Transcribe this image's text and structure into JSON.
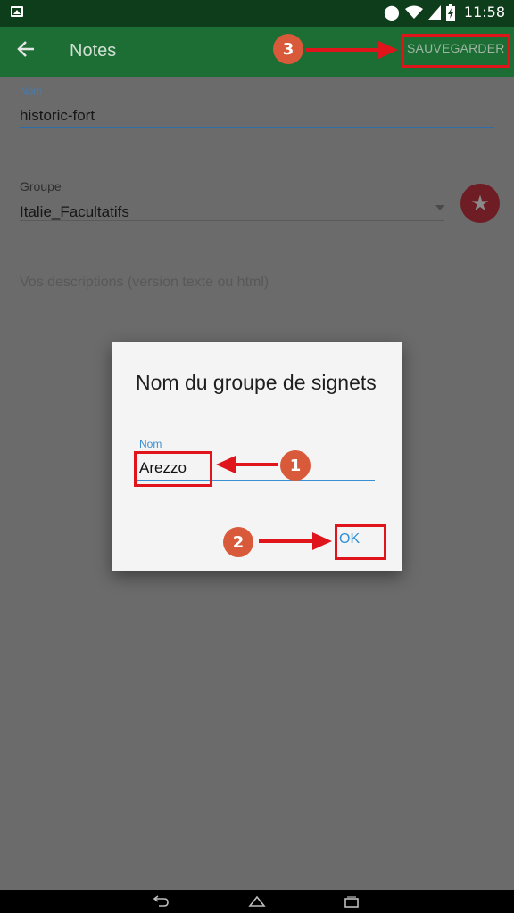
{
  "status_bar": {
    "time": "11:58"
  },
  "app_bar": {
    "title": "Notes",
    "save_label": "SAUVEGARDER"
  },
  "form": {
    "name_label": "Nom",
    "name_value": "historic-fort",
    "group_label": "Groupe",
    "group_value": "Italie_Facultatifs",
    "description_placeholder": "Vos descriptions (version texte ou html)"
  },
  "dialog": {
    "title": "Nom du groupe de signets",
    "field_label": "Nom",
    "field_value": "Arezzo",
    "ok_label": "OK"
  },
  "annotations": {
    "step1": "1",
    "step2": "2",
    "step3": "3",
    "color": "#e0141b"
  },
  "colors": {
    "status_bar": "#0e3d1b",
    "app_bar": "#1d6e35",
    "accent": "#3a8fd2",
    "favorite_button": "#6e1d24"
  }
}
